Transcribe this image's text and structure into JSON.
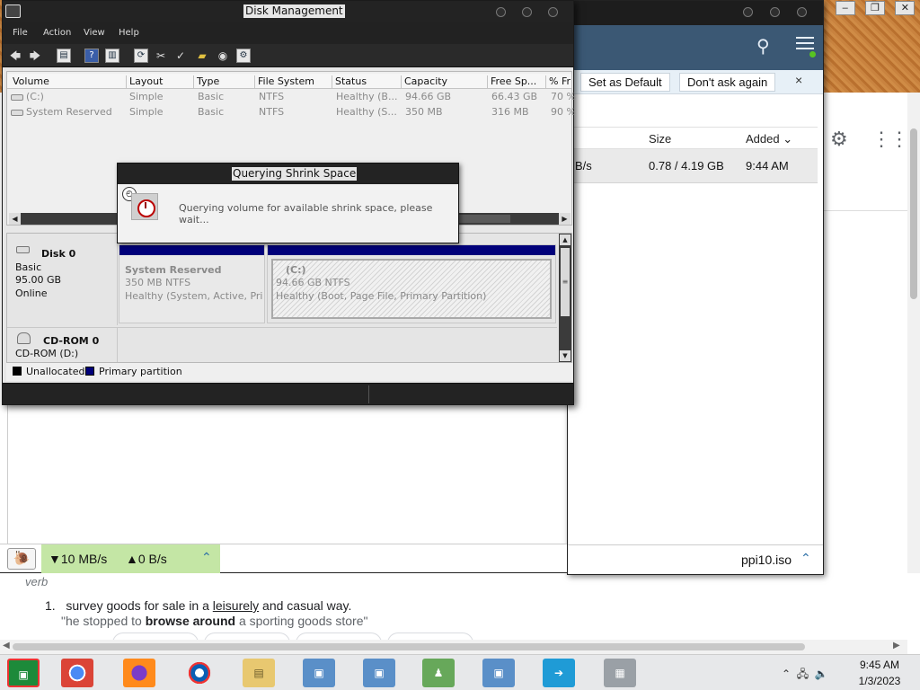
{
  "background_browser": {
    "window_controls": [
      "–",
      "❐",
      "✕"
    ],
    "notify_bar": {
      "set_default": "Set as Default",
      "dont_ask": "Don't ask again",
      "close": "×"
    },
    "table_headers": {
      "size": "Size",
      "added": "Added ⌄"
    },
    "download_row": {
      "speed": "B/s",
      "size": "0.78 / 4.19 GB",
      "added": "9:44 AM"
    },
    "status": {
      "turtle_icon": "turtle-icon",
      "down_speed": "▼10 MB/s",
      "up_speed": "▲0 B/s",
      "filename": "ppi10.iso"
    }
  },
  "dictionary": {
    "part_of_speech": "verb",
    "definition_number": "1.",
    "definition_pre": "survey goods for sale in a ",
    "definition_link": "leisurely",
    "definition_post": " and casual way.",
    "example_pre": "\"he stopped to ",
    "example_bold": "browse around",
    "example_post": " a sporting goods store\""
  },
  "disk_management": {
    "title": "Disk Management",
    "menu": [
      "File",
      "Action",
      "View",
      "Help"
    ],
    "columns": [
      "Volume",
      "Layout",
      "Type",
      "File System",
      "Status",
      "Capacity",
      "Free Sp...",
      "% Fr"
    ],
    "volumes": [
      {
        "volume": "(C:)",
        "layout": "Simple",
        "type": "Basic",
        "fs": "NTFS",
        "status": "Healthy (B...",
        "capacity": "94.66 GB",
        "free": "66.43 GB",
        "pct": "70 %"
      },
      {
        "volume": "System Reserved",
        "layout": "Simple",
        "type": "Basic",
        "fs": "NTFS",
        "status": "Healthy (S...",
        "capacity": "350 MB",
        "free": "316 MB",
        "pct": "90 %"
      }
    ],
    "disk0": {
      "name": "Disk 0",
      "kind": "Basic",
      "size": "95.00 GB",
      "state": "Online",
      "partitions": [
        {
          "name": "System Reserved",
          "size": "350 MB NTFS",
          "status": "Healthy (System, Active, Prin"
        },
        {
          "name": "(C:)",
          "size": "94.66 GB NTFS",
          "status": "Healthy (Boot, Page File, Primary Partition)"
        }
      ]
    },
    "cdrom": {
      "name": "CD-ROM 0",
      "label": "CD-ROM (D:)"
    },
    "legend": {
      "unallocated": "Unallocated",
      "primary": "Primary partition",
      "unallocated_color": "#000000",
      "primary_color": "#00007a"
    }
  },
  "shrink_dialog": {
    "title": "Querying Shrink Space",
    "message": "Querying volume for available shrink space, please wait..."
  },
  "taskbar": {
    "time": "9:45 AM",
    "date": "1/3/2023"
  }
}
